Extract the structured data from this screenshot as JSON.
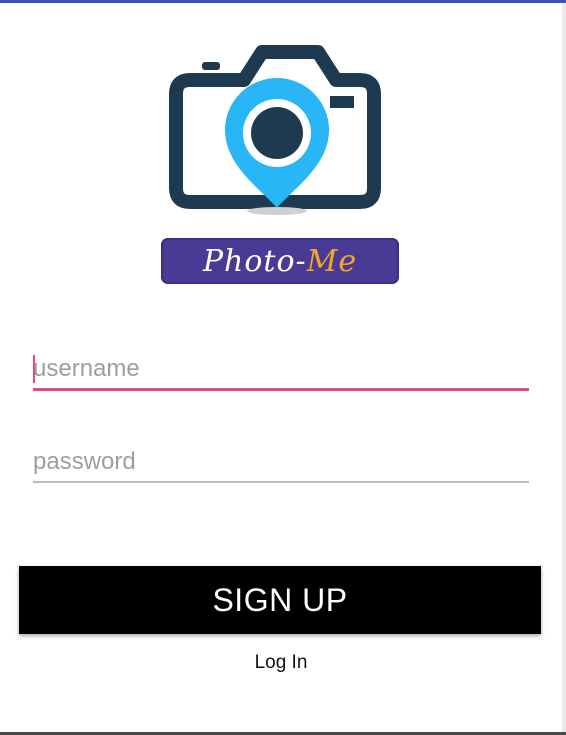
{
  "brand": {
    "name_part1": "Photo-",
    "name_part2": "Me",
    "badge_color": "#473b96",
    "accent_color": "#f5a623",
    "camera_color": "#1e3a50",
    "pin_color": "#29b6f6",
    "logo_icon": "camera-location-pin-icon"
  },
  "form": {
    "username": {
      "placeholder": "username",
      "value": "",
      "focused": true
    },
    "password": {
      "placeholder": "password",
      "value": ""
    }
  },
  "actions": {
    "signup_label": "SIGN UP",
    "login_label": "Log In"
  },
  "theme": {
    "focus_color": "#e8487c",
    "top_bar_color": "#3f51b5",
    "button_bg": "#000000"
  }
}
